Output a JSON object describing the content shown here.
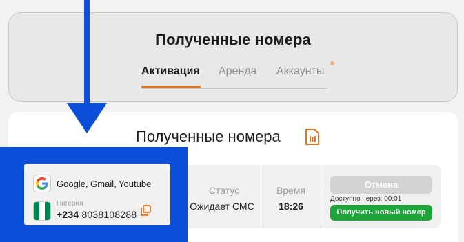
{
  "header": {
    "title": "Полученные номера",
    "tabs": [
      {
        "label": "Активация",
        "active": true
      },
      {
        "label": "Аренда",
        "active": false
      },
      {
        "label": "Аккаунты",
        "active": false
      }
    ]
  },
  "section": {
    "title": "Полученные номера",
    "icon": "sim-card-icon"
  },
  "order": {
    "service": "Google, Gmail, Youtube",
    "service_icon": "google-icon",
    "country_label": "Нигерия",
    "phone_code": "+234",
    "phone_number": "8038108288",
    "status_label": "Статус",
    "status_value": "Ожидает СМС",
    "time_label": "Время",
    "time_value": "18:26",
    "cancel_label": "Отмена",
    "available_text": "Доступно через: 00:01",
    "new_number_label": "Получить новый номер"
  },
  "colors": {
    "accent": "#e8731a",
    "highlight": "#0b4fd8",
    "success": "#1ea53a",
    "disabled": "#d3d3d3",
    "flag_green": "#008751"
  }
}
